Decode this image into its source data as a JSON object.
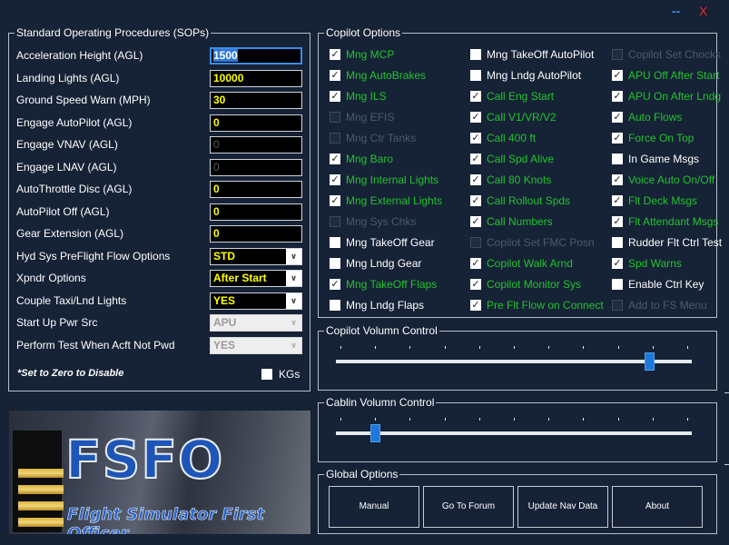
{
  "window": {
    "minimize_label": "--",
    "close_label": "X"
  },
  "sop": {
    "title": "Standard Operating Procedures (SOPs)",
    "rows": [
      {
        "label": "Acceleration Height (AGL)",
        "value": "1500",
        "kind": "input",
        "state": "focused"
      },
      {
        "label": "Landing Lights (AGL)",
        "value": "10000",
        "kind": "input",
        "state": "enabled"
      },
      {
        "label": "Ground Speed Warn (MPH)",
        "value": "30",
        "kind": "input",
        "state": "enabled"
      },
      {
        "label": "Engage AutoPilot (AGL)",
        "value": "0",
        "kind": "input",
        "state": "enabled"
      },
      {
        "label": "Engage VNAV (AGL)",
        "value": "0",
        "kind": "input",
        "state": "disabled"
      },
      {
        "label": "Engage LNAV (AGL)",
        "value": "0",
        "kind": "input",
        "state": "disabled"
      },
      {
        "label": "AutoThrottle Disc (AGL)",
        "value": "0",
        "kind": "input",
        "state": "enabled"
      },
      {
        "label": "AutoPilot Off (AGL)",
        "value": "0",
        "kind": "input",
        "state": "enabled"
      },
      {
        "label": "Gear Extension (AGL)",
        "value": "0",
        "kind": "input",
        "state": "enabled"
      },
      {
        "label": "Hyd Sys PreFlight Flow Options",
        "value": "STD",
        "kind": "select",
        "state": "enabled"
      },
      {
        "label": "Xpndr Options",
        "value": "After Start",
        "kind": "select",
        "state": "enabled"
      },
      {
        "label": "Couple Taxi/Lnd Lights",
        "value": "YES",
        "kind": "select",
        "state": "enabled"
      },
      {
        "label": "Start Up Pwr Src",
        "value": "APU",
        "kind": "select",
        "state": "disabled"
      },
      {
        "label": "Perform Test When Acft Not Pwd",
        "value": "YES",
        "kind": "select",
        "state": "disabled"
      }
    ],
    "note": "*Set to Zero to Disable",
    "kgs_label": "KGs",
    "kgs_checked": false
  },
  "copilot_options": {
    "title": "Copilot Options",
    "columns": [
      [
        {
          "label": "Mng MCP",
          "checked": true,
          "state": "green"
        },
        {
          "label": "Mng AutoBrakes",
          "checked": true,
          "state": "green"
        },
        {
          "label": "Mng ILS",
          "checked": true,
          "state": "green"
        },
        {
          "label": "Mng EFIS",
          "checked": false,
          "state": "disabled"
        },
        {
          "label": "Mng Ctr Tanks",
          "checked": false,
          "state": "disabled"
        },
        {
          "label": "Mng Baro",
          "checked": true,
          "state": "green"
        },
        {
          "label": "Mng Internal Lights",
          "checked": true,
          "state": "green"
        },
        {
          "label": "Mng External Lights",
          "checked": true,
          "state": "green"
        },
        {
          "label": "Mng Sys Chks",
          "checked": false,
          "state": "disabled"
        },
        {
          "label": "Mng TakeOff Gear",
          "checked": false,
          "state": "white"
        },
        {
          "label": "Mng Lndg Gear",
          "checked": false,
          "state": "white"
        },
        {
          "label": "Mng TakeOff Flaps",
          "checked": true,
          "state": "green"
        },
        {
          "label": "Mng Lndg Flaps",
          "checked": false,
          "state": "white"
        }
      ],
      [
        {
          "label": "Mng TakeOff AutoPilot",
          "checked": false,
          "state": "white"
        },
        {
          "label": "Mng Lndg AutoPilot",
          "checked": false,
          "state": "white"
        },
        {
          "label": "Call Eng Start",
          "checked": true,
          "state": "green"
        },
        {
          "label": "Call V1/VR/V2",
          "checked": true,
          "state": "green"
        },
        {
          "label": "Call 400 ft",
          "checked": true,
          "state": "green"
        },
        {
          "label": "Call Spd Alive",
          "checked": true,
          "state": "green"
        },
        {
          "label": "Call 80 Knots",
          "checked": true,
          "state": "green"
        },
        {
          "label": "Call Rollout Spds",
          "checked": true,
          "state": "green"
        },
        {
          "label": "Call Numbers",
          "checked": true,
          "state": "green"
        },
        {
          "label": "Copilot Set FMC Posn",
          "checked": false,
          "state": "disabled"
        },
        {
          "label": "Copilot Walk Arnd",
          "checked": true,
          "state": "green"
        },
        {
          "label": "Copilot Monitor Sys",
          "checked": true,
          "state": "green"
        },
        {
          "label": "Pre Flt Flow on Connect",
          "checked": true,
          "state": "green"
        }
      ],
      [
        {
          "label": "Copilot Set Chocks",
          "checked": false,
          "state": "disabled"
        },
        {
          "label": "APU Off After Start",
          "checked": true,
          "state": "green"
        },
        {
          "label": "APU On After Lndg",
          "checked": true,
          "state": "green"
        },
        {
          "label": "Auto Flows",
          "checked": true,
          "state": "green"
        },
        {
          "label": "Force On Top",
          "checked": true,
          "state": "green"
        },
        {
          "label": "In Game Msgs",
          "checked": false,
          "state": "white"
        },
        {
          "label": "Voice Auto On/Off",
          "checked": true,
          "state": "green"
        },
        {
          "label": "Flt Deck Msgs",
          "checked": true,
          "state": "green"
        },
        {
          "label": "Flt Attendant Msgs",
          "checked": true,
          "state": "green"
        },
        {
          "label": "Rudder Flt Ctrl Test",
          "checked": false,
          "state": "white"
        },
        {
          "label": "Spd Warns",
          "checked": true,
          "state": "green"
        },
        {
          "label": "Enable Ctrl Key",
          "checked": false,
          "state": "white"
        },
        {
          "label": "Add to FS Menu",
          "checked": false,
          "state": "disabled"
        }
      ]
    ]
  },
  "copilot_volume": {
    "title": "Copilot Volumn Control",
    "level": 0.88,
    "ticks": 11
  },
  "cabin_volume": {
    "title": "Cablin Volumn Control",
    "level": 0.11,
    "ticks": 11
  },
  "global_options": {
    "title": "Global Options",
    "buttons": [
      "Manual",
      "Go To Forum",
      "Update Nav Data",
      "About"
    ]
  },
  "logo": {
    "text": "FSFO",
    "subtitle": "Flight Simulator First Officer"
  },
  "colors": {
    "background": "#162236",
    "checked_label": "#22c42e",
    "value_text": "#ffff00",
    "accent": "#1f78d8",
    "close": "#e8262a"
  }
}
